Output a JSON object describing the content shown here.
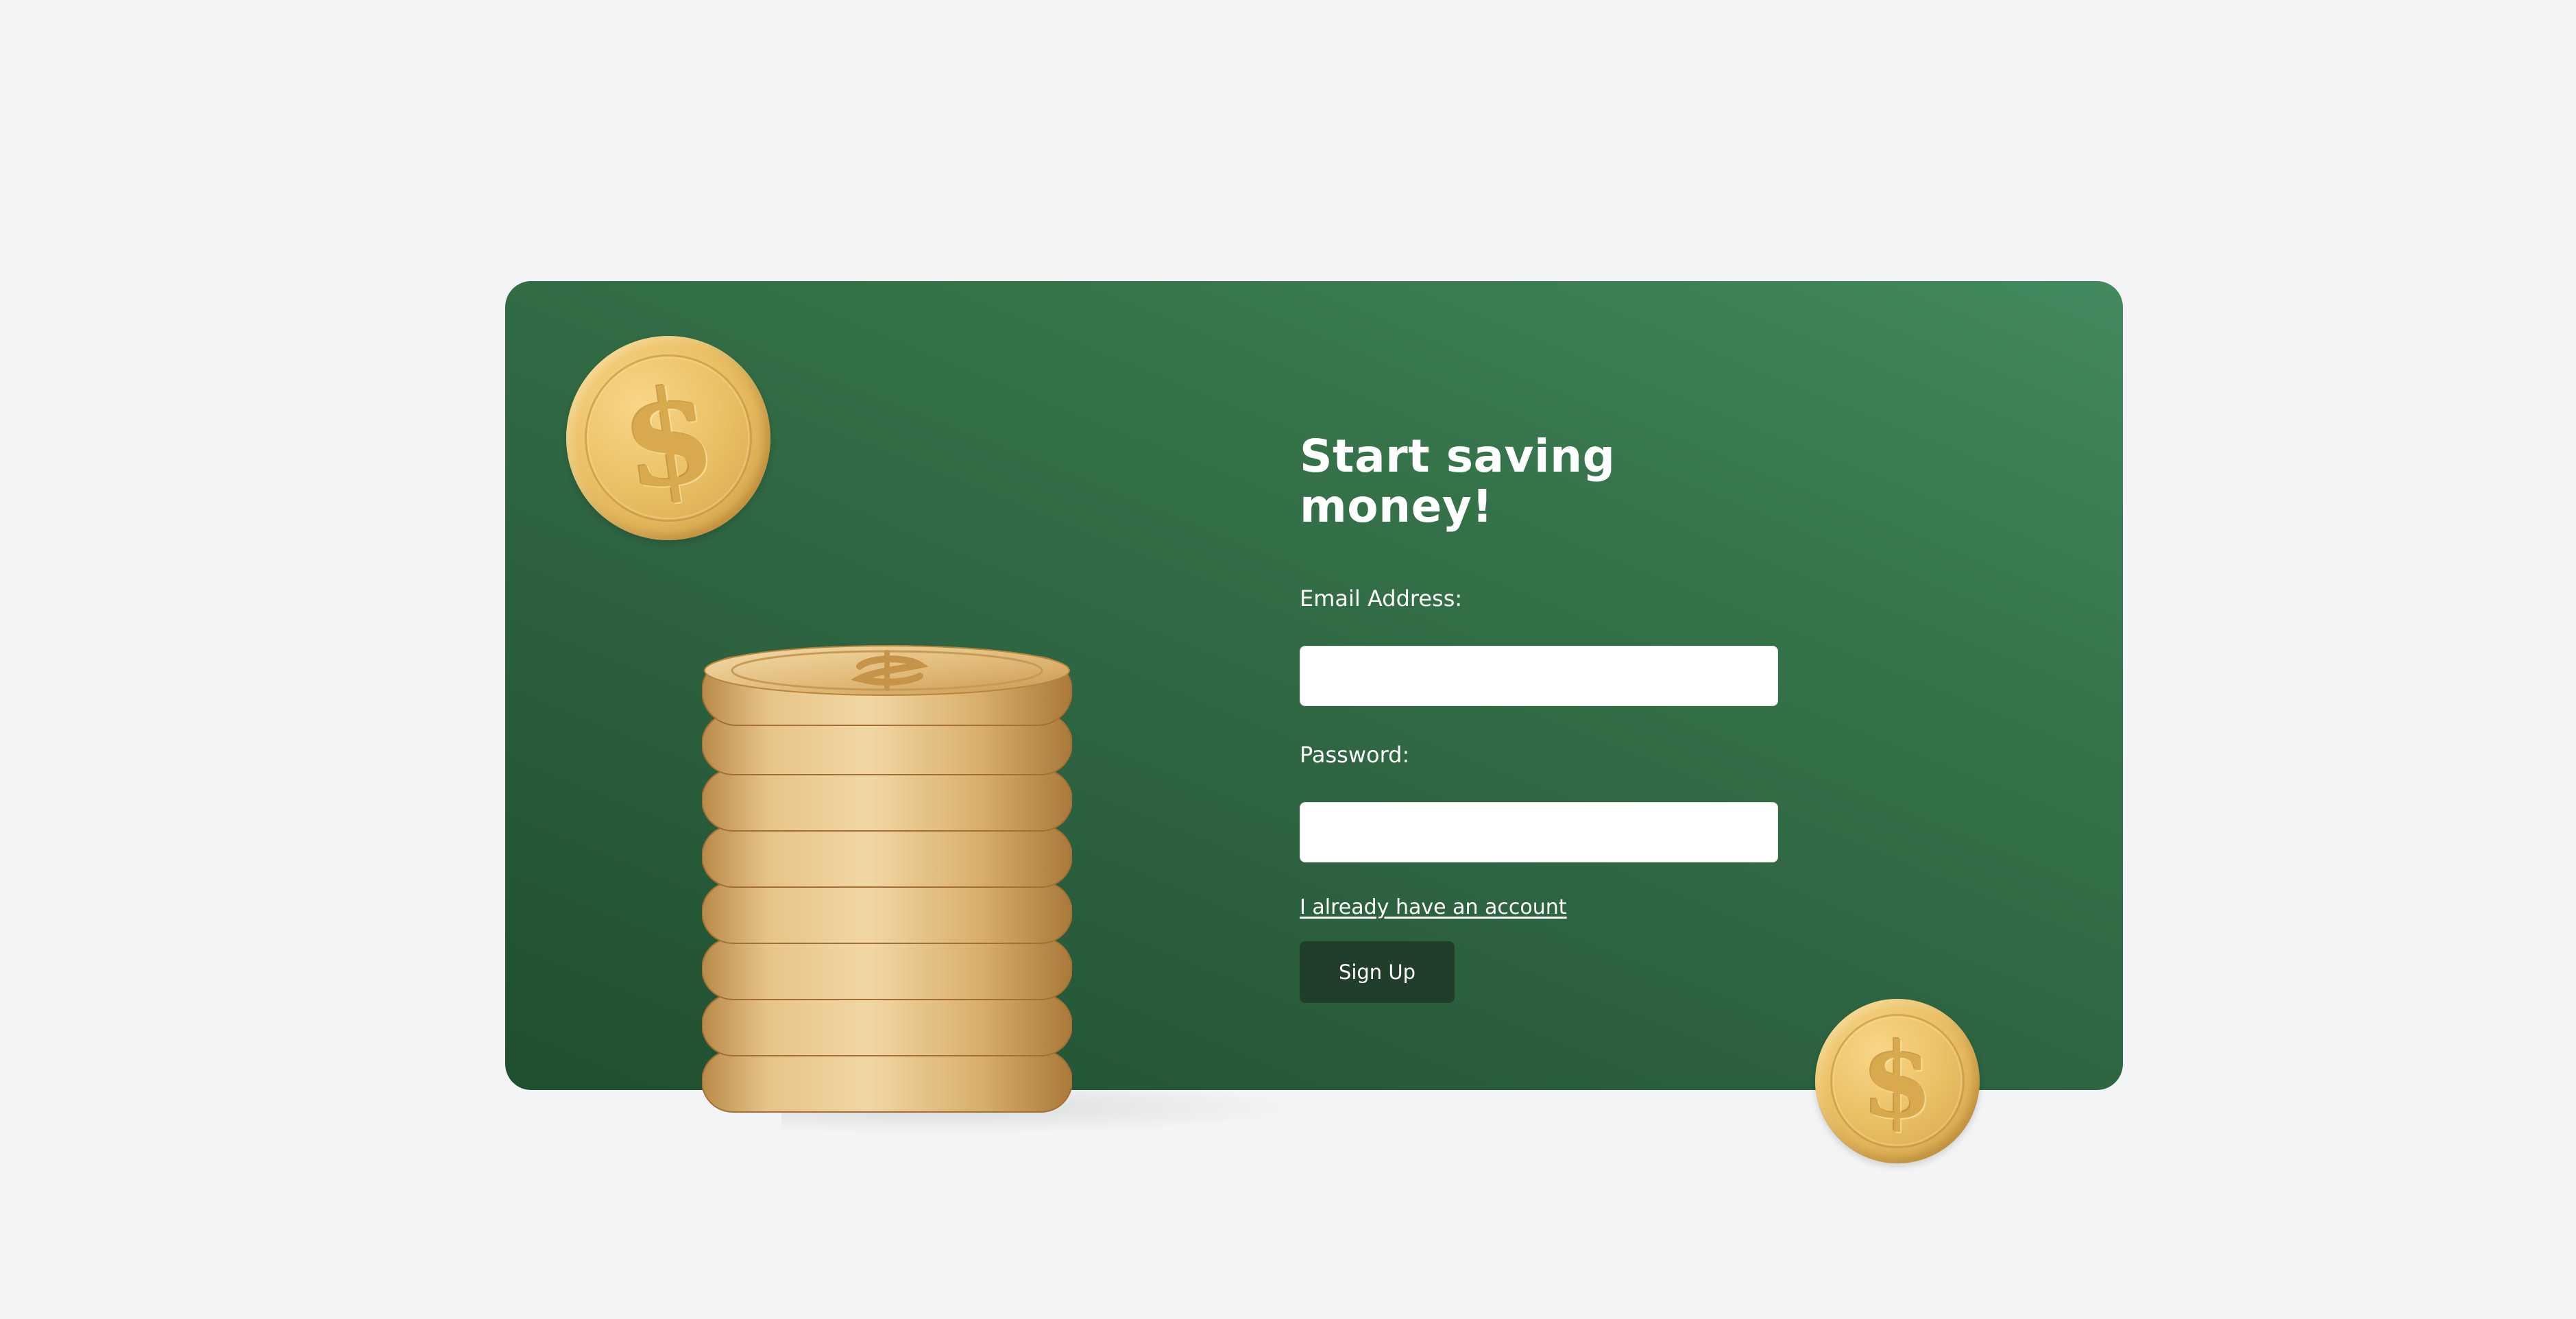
{
  "signup": {
    "title": "Start saving money!",
    "email_label": "Email Address:",
    "email_value": "",
    "password_label": "Password:",
    "password_value": "",
    "login_link": "I already have an account",
    "submit_label": "Sign Up"
  },
  "decor": {
    "coin_icon_name": "dollar-coin-icon",
    "coin_stack_name": "coin-stack-illustration"
  },
  "colors": {
    "background": "#f3f4f6",
    "card_gradient_start": "#1f4f2f",
    "card_gradient_end": "#44895f",
    "button": "#213e2a",
    "coin_gold": "#e9bf63"
  }
}
